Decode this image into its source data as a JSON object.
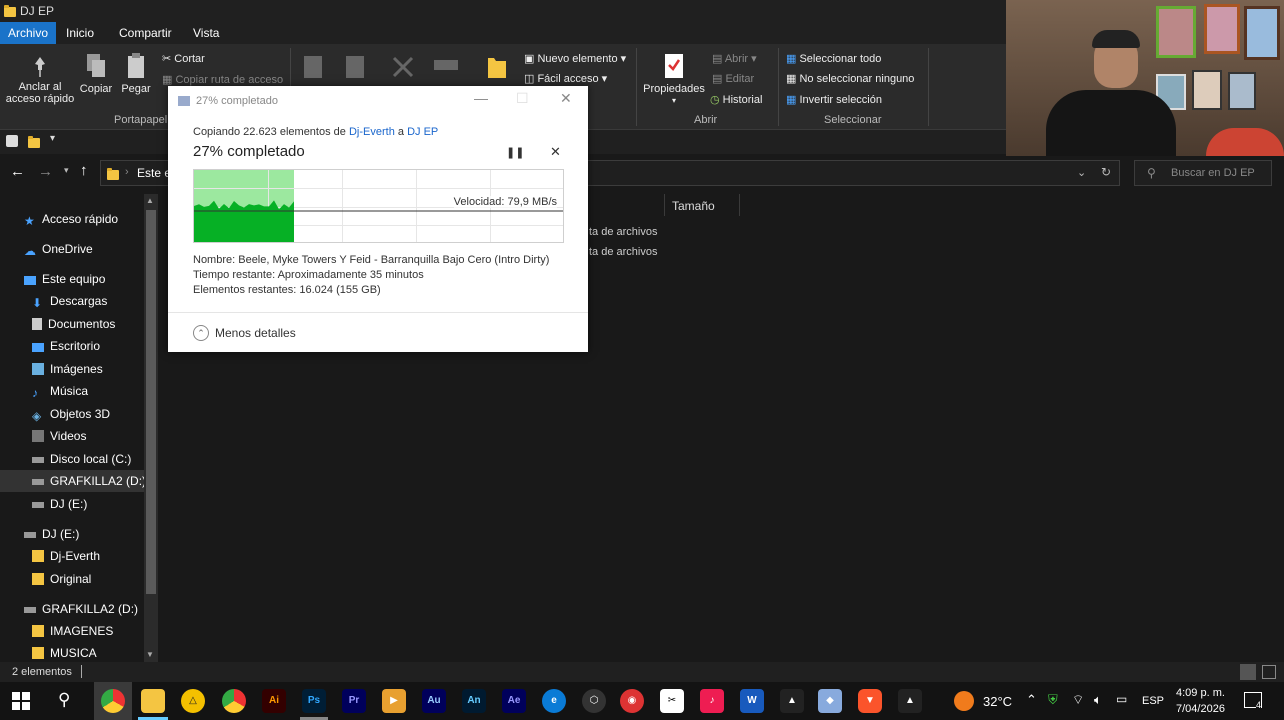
{
  "window": {
    "title": "DJ EP"
  },
  "menu_tabs": [
    "Archivo",
    "Inicio",
    "Compartir",
    "Vista"
  ],
  "ribbon": {
    "pin_label": "Anclar al acceso rápido",
    "copy_label": "Copiar",
    "paste_label": "Pegar",
    "cut_label": "Cortar",
    "copy_path_label": "Copiar ruta de acceso",
    "new_item_label": "Nuevo elemento",
    "easy_access_label": "Fácil acceso",
    "properties_label": "Propiedades",
    "open_label": "Abrir",
    "edit_label": "Editar",
    "history_label": "Historial",
    "select_all_label": "Seleccionar todo",
    "select_none_label": "No seleccionar ninguno",
    "invert_selection_label": "Invertir selección",
    "group_clipboard": "Portapapel",
    "group_open": "Abrir",
    "group_select": "Seleccionar"
  },
  "address": {
    "path_partial": "Este e",
    "search_placeholder": "Buscar en DJ EP"
  },
  "nav": [
    {
      "label": "Acceso rápido",
      "icon": "star-icon"
    },
    {
      "label": "OneDrive",
      "icon": "cloud-icon"
    },
    {
      "label": "Este equipo",
      "icon": "computer-icon"
    },
    {
      "label": "Descargas",
      "icon": "download-icon"
    },
    {
      "label": "Documentos",
      "icon": "document-icon"
    },
    {
      "label": "Escritorio",
      "icon": "desktop-icon"
    },
    {
      "label": "Imágenes",
      "icon": "pictures-icon"
    },
    {
      "label": "Música",
      "icon": "music-icon"
    },
    {
      "label": "Objetos 3D",
      "icon": "cube-icon"
    },
    {
      "label": "Videos",
      "icon": "video-icon"
    },
    {
      "label": "Disco local (C:)",
      "icon": "drive-icon"
    },
    {
      "label": "GRAFKILLA2 (D:)",
      "icon": "drive-icon"
    },
    {
      "label": "DJ (E:)",
      "icon": "drive-icon"
    },
    {
      "label": "DJ (E:)",
      "icon": "drive-icon"
    },
    {
      "label": "Dj-Everth",
      "icon": "folder-icon"
    },
    {
      "label": "Original",
      "icon": "folder-icon"
    },
    {
      "label": "GRAFKILLA2 (D:)",
      "icon": "drive-icon"
    },
    {
      "label": "IMAGENES",
      "icon": "folder-icon"
    },
    {
      "label": "MUSICA",
      "icon": "folder-icon"
    }
  ],
  "content": {
    "column_size": "Tamaño",
    "rows": [
      "ta de archivos",
      "ta de archivos"
    ]
  },
  "status": {
    "count": "2 elementos"
  },
  "dialog": {
    "title": "27% completado",
    "copy_prefix": "Copiando 22.623 elementos de",
    "source": "Dj-Everth",
    "mid": "a",
    "dest": "DJ EP",
    "heading": "27% completado",
    "progress": 0.27,
    "speed": "Velocidad: 79,9 MB/s",
    "name_line": "Nombre: Beele, Myke Towers Y Feid - Barranquilla Bajo Cero (Intro Dirty)",
    "time_line": "Tiempo restante:  Aproximadamente 35 minutos",
    "items_line": "Elementos restantes:  16.024 (155 GB)",
    "less_details": "Menos detalles"
  },
  "taskbar": {
    "temperature": "32°C",
    "language": "ESP",
    "time": "4:09 p. m.",
    "date": "7/04/2026",
    "notifications": "4"
  },
  "colors": {
    "accent": "#1a73c9",
    "progress_green": "#06b025",
    "progress_light": "#9ce89f",
    "link": "#1a66cc"
  }
}
